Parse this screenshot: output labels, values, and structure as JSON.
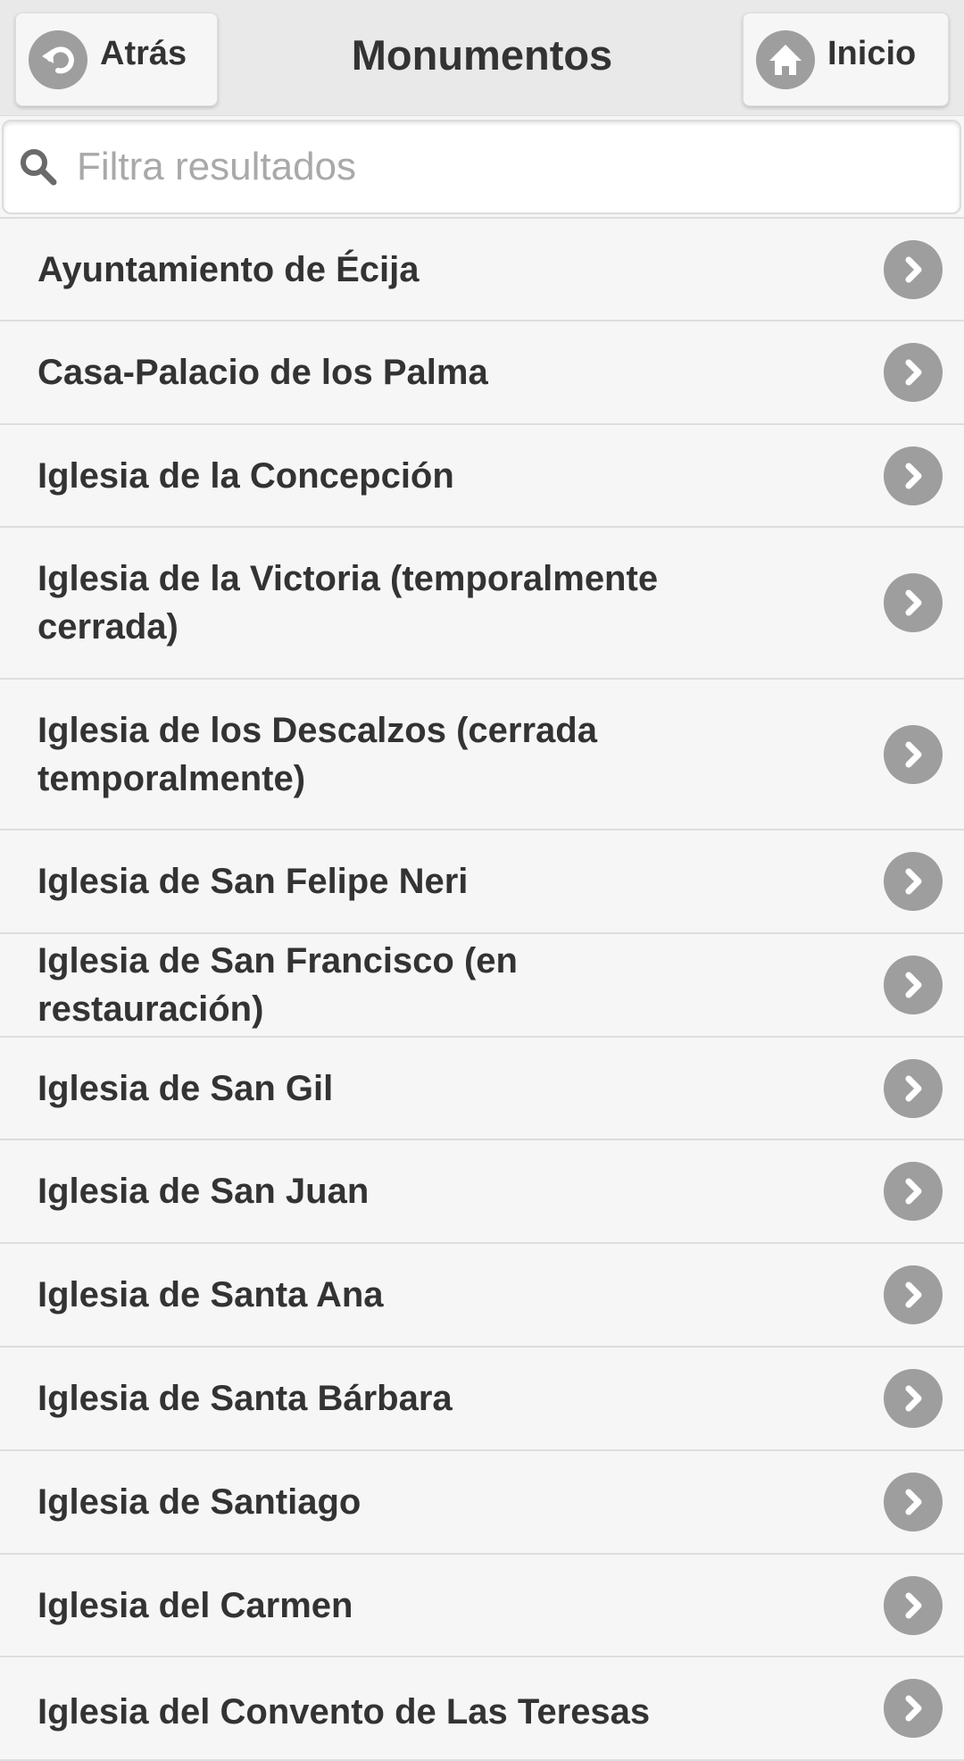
{
  "header": {
    "title": "Monumentos",
    "back_label": "Atrás",
    "home_label": "Inicio"
  },
  "search": {
    "placeholder": "Filtra resultados",
    "value": ""
  },
  "items": [
    {
      "label": "Ayuntamiento de Écija"
    },
    {
      "label": "Casa-Palacio de los Palma"
    },
    {
      "label": "Iglesia de la Concepción"
    },
    {
      "label": "Iglesia de la Victoria (temporalmente cerrada)"
    },
    {
      "label": "Iglesia de los Descalzos (cerrada temporalmente)"
    },
    {
      "label": "Iglesia de San Felipe Neri"
    },
    {
      "label": "Iglesia de San Francisco (en restauración)"
    },
    {
      "label": "Iglesia de San Gil"
    },
    {
      "label": "Iglesia de San Juan"
    },
    {
      "label": "Iglesia de Santa Ana"
    },
    {
      "label": "Iglesia de Santa Bárbara"
    },
    {
      "label": "Iglesia de Santiago"
    },
    {
      "label": "Iglesia del Carmen"
    },
    {
      "label": "Iglesia del Convento de Las Teresas"
    }
  ],
  "icons": {
    "back": "back-arrow-icon",
    "home": "home-icon",
    "search": "search-icon",
    "item_arrow": "chevron-right-icon"
  },
  "colors": {
    "header_bg": "#e9e9e9",
    "list_bg": "#f6f6f6",
    "icon_circle": "#9e9e9e",
    "text": "#333333",
    "placeholder": "#a9a9a9"
  }
}
